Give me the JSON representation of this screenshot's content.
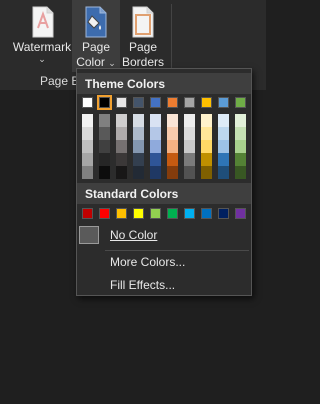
{
  "ribbon": {
    "watermark_label": "Watermark",
    "page_color_line1": "Page",
    "page_color_line2": "Color",
    "page_borders_line1": "Page",
    "page_borders_line2": "Borders",
    "group_label": "Page B",
    "chevron": "⌄"
  },
  "dropdown": {
    "theme_colors_header": "Theme Colors",
    "standard_colors_header": "Standard Colors",
    "no_color_label": "No Color",
    "more_colors_label": "More Colors...",
    "fill_effects_label": "Fill Effects...",
    "theme_top_row": [
      "#ffffff",
      "#000000",
      "#e7e6e6",
      "#44546a",
      "#4472c4",
      "#ed7d31",
      "#a5a5a5",
      "#ffc000",
      "#5b9bd5",
      "#70ad47"
    ],
    "theme_shades": [
      [
        "#f2f2f2",
        "#d9d9d9",
        "#bfbfbf",
        "#a6a6a6",
        "#808080"
      ],
      [
        "#808080",
        "#595959",
        "#404040",
        "#262626",
        "#0d0d0d"
      ],
      [
        "#d0cece",
        "#afabab",
        "#767171",
        "#3b3838",
        "#181717"
      ],
      [
        "#d6dce4",
        "#adb9ca",
        "#8497b0",
        "#333f4f",
        "#222a35"
      ],
      [
        "#d9e2f3",
        "#b4c7e7",
        "#8faadc",
        "#2f5597",
        "#1f3864"
      ],
      [
        "#fbe5d6",
        "#f8cbad",
        "#f4b183",
        "#c55a11",
        "#843c0c"
      ],
      [
        "#ededed",
        "#dbdbdb",
        "#c9c9c9",
        "#7b7b7b",
        "#525252"
      ],
      [
        "#fff2cc",
        "#ffe699",
        "#ffd966",
        "#bf9000",
        "#7f6000"
      ],
      [
        "#deebf7",
        "#bdd7ee",
        "#9dc3e6",
        "#2e75b6",
        "#1f4e79"
      ],
      [
        "#e2f0d9",
        "#c5e0b4",
        "#a9d18e",
        "#548235",
        "#385723"
      ]
    ],
    "standard_colors": [
      "#c00000",
      "#ff0000",
      "#ffc000",
      "#ffff00",
      "#92d050",
      "#00b050",
      "#00b0f0",
      "#0070c0",
      "#002060",
      "#7030a0"
    ]
  }
}
